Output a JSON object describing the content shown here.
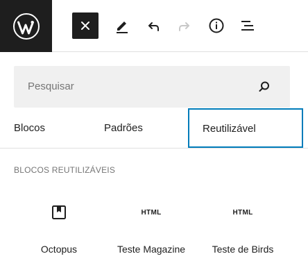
{
  "toolbar": {
    "logo": "wordpress-icon",
    "buttons": [
      "close-icon",
      "pencil-icon",
      "undo-icon",
      "redo-icon",
      "info-icon",
      "list-view-icon"
    ]
  },
  "search": {
    "placeholder": "Pesquisar",
    "icon": "search-icon"
  },
  "tabs": [
    {
      "label": "Blocos",
      "selected": false
    },
    {
      "label": "Padrões",
      "selected": false
    },
    {
      "label": "Reutilizável",
      "selected": true
    }
  ],
  "section": {
    "title": "BLOCOS REUTILIZÁVEIS"
  },
  "blocks": [
    {
      "icon": "bookmark-block-icon",
      "label": "Octopus"
    },
    {
      "icon_text": "HTML",
      "label": "Teste Magazine"
    },
    {
      "icon_text": "HTML",
      "label": "Teste de Birds"
    }
  ],
  "colors": {
    "accent": "#007cba",
    "dark": "#1e1e1e",
    "muted": "#757575",
    "search_bg": "#f0f0f0"
  }
}
